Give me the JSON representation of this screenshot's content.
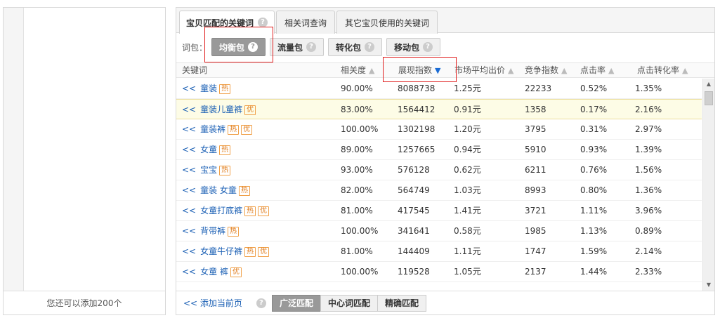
{
  "left": {
    "footer_text": "您还可以添加200个"
  },
  "tabs": [
    {
      "label": "宝贝匹配的关键词",
      "active": true,
      "help": "?"
    },
    {
      "label": "相关词查询",
      "active": false
    },
    {
      "label": "其它宝贝使用的关键词",
      "active": false
    }
  ],
  "packages": {
    "label": "词包：",
    "items": [
      {
        "label": "均衡包",
        "active": true,
        "help": "?"
      },
      {
        "label": "流量包",
        "active": false,
        "help": "?"
      },
      {
        "label": "转化包",
        "active": false,
        "help": "?"
      },
      {
        "label": "移动包",
        "active": false,
        "help": "?"
      }
    ]
  },
  "table": {
    "columns": [
      {
        "label": "关键词",
        "sort": "none"
      },
      {
        "label": "相关度",
        "sort": "up-icon"
      },
      {
        "label": "展现指数",
        "sort": "down-icon-active"
      },
      {
        "label": "市场平均出价",
        "sort": "up-icon"
      },
      {
        "label": "竞争指数",
        "sort": "up-icon"
      },
      {
        "label": "点击率",
        "sort": "up-icon"
      },
      {
        "label": "点击转化率",
        "sort": "up-icon"
      }
    ],
    "rows": [
      {
        "prefix": "<<",
        "keyword": "童装",
        "tags": [
          "热"
        ],
        "relevance": "90.00%",
        "impressions": "8088738",
        "avg_bid": "1.25元",
        "competition": "22233",
        "ctr": "0.52%",
        "cvr": "1.35%"
      },
      {
        "prefix": "<<",
        "keyword": "童装儿童裤",
        "tags": [
          "优"
        ],
        "relevance": "83.00%",
        "impressions": "1564412",
        "avg_bid": "0.91元",
        "competition": "1358",
        "ctr": "0.17%",
        "cvr": "2.16%",
        "highlight": true
      },
      {
        "prefix": "<<",
        "keyword": "童装裤",
        "tags": [
          "热",
          "优"
        ],
        "relevance": "100.00%",
        "impressions": "1302198",
        "avg_bid": "1.20元",
        "competition": "3795",
        "ctr": "0.31%",
        "cvr": "2.97%"
      },
      {
        "prefix": "<<",
        "keyword": "女童",
        "tags": [
          "热"
        ],
        "relevance": "89.00%",
        "impressions": "1257665",
        "avg_bid": "0.94元",
        "competition": "5910",
        "ctr": "0.93%",
        "cvr": "1.39%"
      },
      {
        "prefix": "<<",
        "keyword": "宝宝",
        "tags": [
          "热"
        ],
        "relevance": "93.00%",
        "impressions": "576128",
        "avg_bid": "0.62元",
        "competition": "6211",
        "ctr": "0.76%",
        "cvr": "1.56%"
      },
      {
        "prefix": "<<",
        "keyword": "童装 女童",
        "tags": [
          "热"
        ],
        "relevance": "82.00%",
        "impressions": "564749",
        "avg_bid": "1.03元",
        "competition": "8993",
        "ctr": "0.80%",
        "cvr": "1.36%"
      },
      {
        "prefix": "<<",
        "keyword": "女童打底裤",
        "tags": [
          "热",
          "优"
        ],
        "relevance": "81.00%",
        "impressions": "417545",
        "avg_bid": "1.41元",
        "competition": "3721",
        "ctr": "1.11%",
        "cvr": "3.96%"
      },
      {
        "prefix": "<<",
        "keyword": "背带裤",
        "tags": [
          "热"
        ],
        "relevance": "100.00%",
        "impressions": "341641",
        "avg_bid": "0.58元",
        "competition": "1985",
        "ctr": "1.13%",
        "cvr": "0.89%"
      },
      {
        "prefix": "<<",
        "keyword": "女童牛仔裤",
        "tags": [
          "热",
          "优"
        ],
        "relevance": "81.00%",
        "impressions": "144409",
        "avg_bid": "1.11元",
        "competition": "1747",
        "ctr": "1.59%",
        "cvr": "2.14%"
      },
      {
        "prefix": "<<",
        "keyword": "女童 裤",
        "tags": [
          "优"
        ],
        "relevance": "100.00%",
        "impressions": "119528",
        "avg_bid": "1.05元",
        "competition": "2137",
        "ctr": "1.44%",
        "cvr": "2.33%"
      }
    ]
  },
  "footer": {
    "add_label": "<< 添加当前页",
    "help": "?",
    "match_buttons": [
      {
        "label": "广泛匹配",
        "active": true
      },
      {
        "label": "中心词匹配",
        "active": false
      },
      {
        "label": "精确匹配",
        "active": false
      }
    ]
  },
  "scrollbar": {
    "up": "▲",
    "down": "▼"
  }
}
